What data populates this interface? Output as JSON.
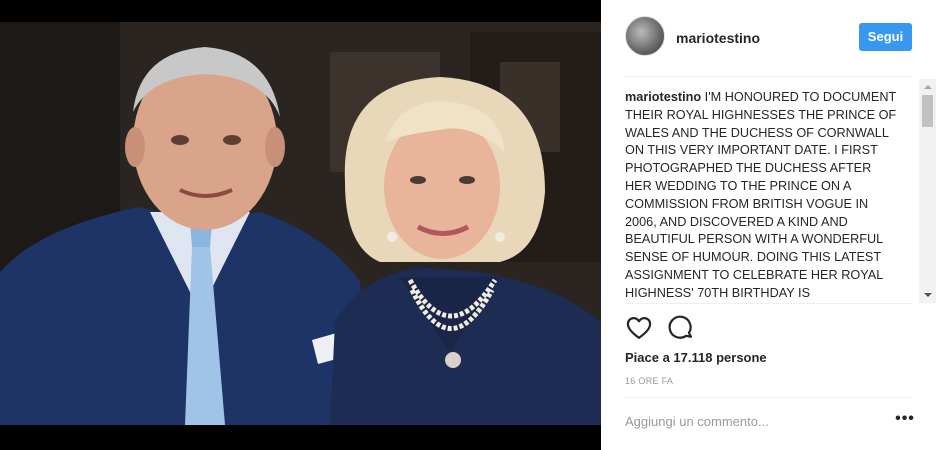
{
  "post": {
    "username": "mariotestino",
    "follow_label": "Segui",
    "caption_user": "mariotestino",
    "caption_text": "I'M HONOURED TO DOCUMENT THEIR ROYAL HIGHNESSES THE PRINCE OF WALES AND THE DUCHESS OF CORNWALL ON THIS VERY IMPORTANT DATE. I FIRST PHOTOGRAPHED THE DUCHESS AFTER HER WEDDING TO THE PRINCE ON A COMMISSION FROM BRITISH VOGUE IN 2006, AND DISCOVERED A KIND AND BEAUTIFUL PERSON WITH A WONDERFUL SENSE OF HUMOUR. DOING THIS LATEST ASSIGNMENT TO CELEBRATE HER ROYAL HIGHNESS' 70TH BIRTHDAY IS",
    "likes_text": "Piace a 17.118 persone",
    "time_text": "16 ORE FA",
    "comment_placeholder": "Aggiungi un commento...",
    "more_label": "•••"
  },
  "icons": {
    "like": "heart-icon",
    "comment": "comment-bubble-icon",
    "more": "more-options-icon"
  },
  "colors": {
    "follow_button": "#3897f0",
    "text": "#262626",
    "muted": "#999999",
    "divider": "#efefef"
  }
}
